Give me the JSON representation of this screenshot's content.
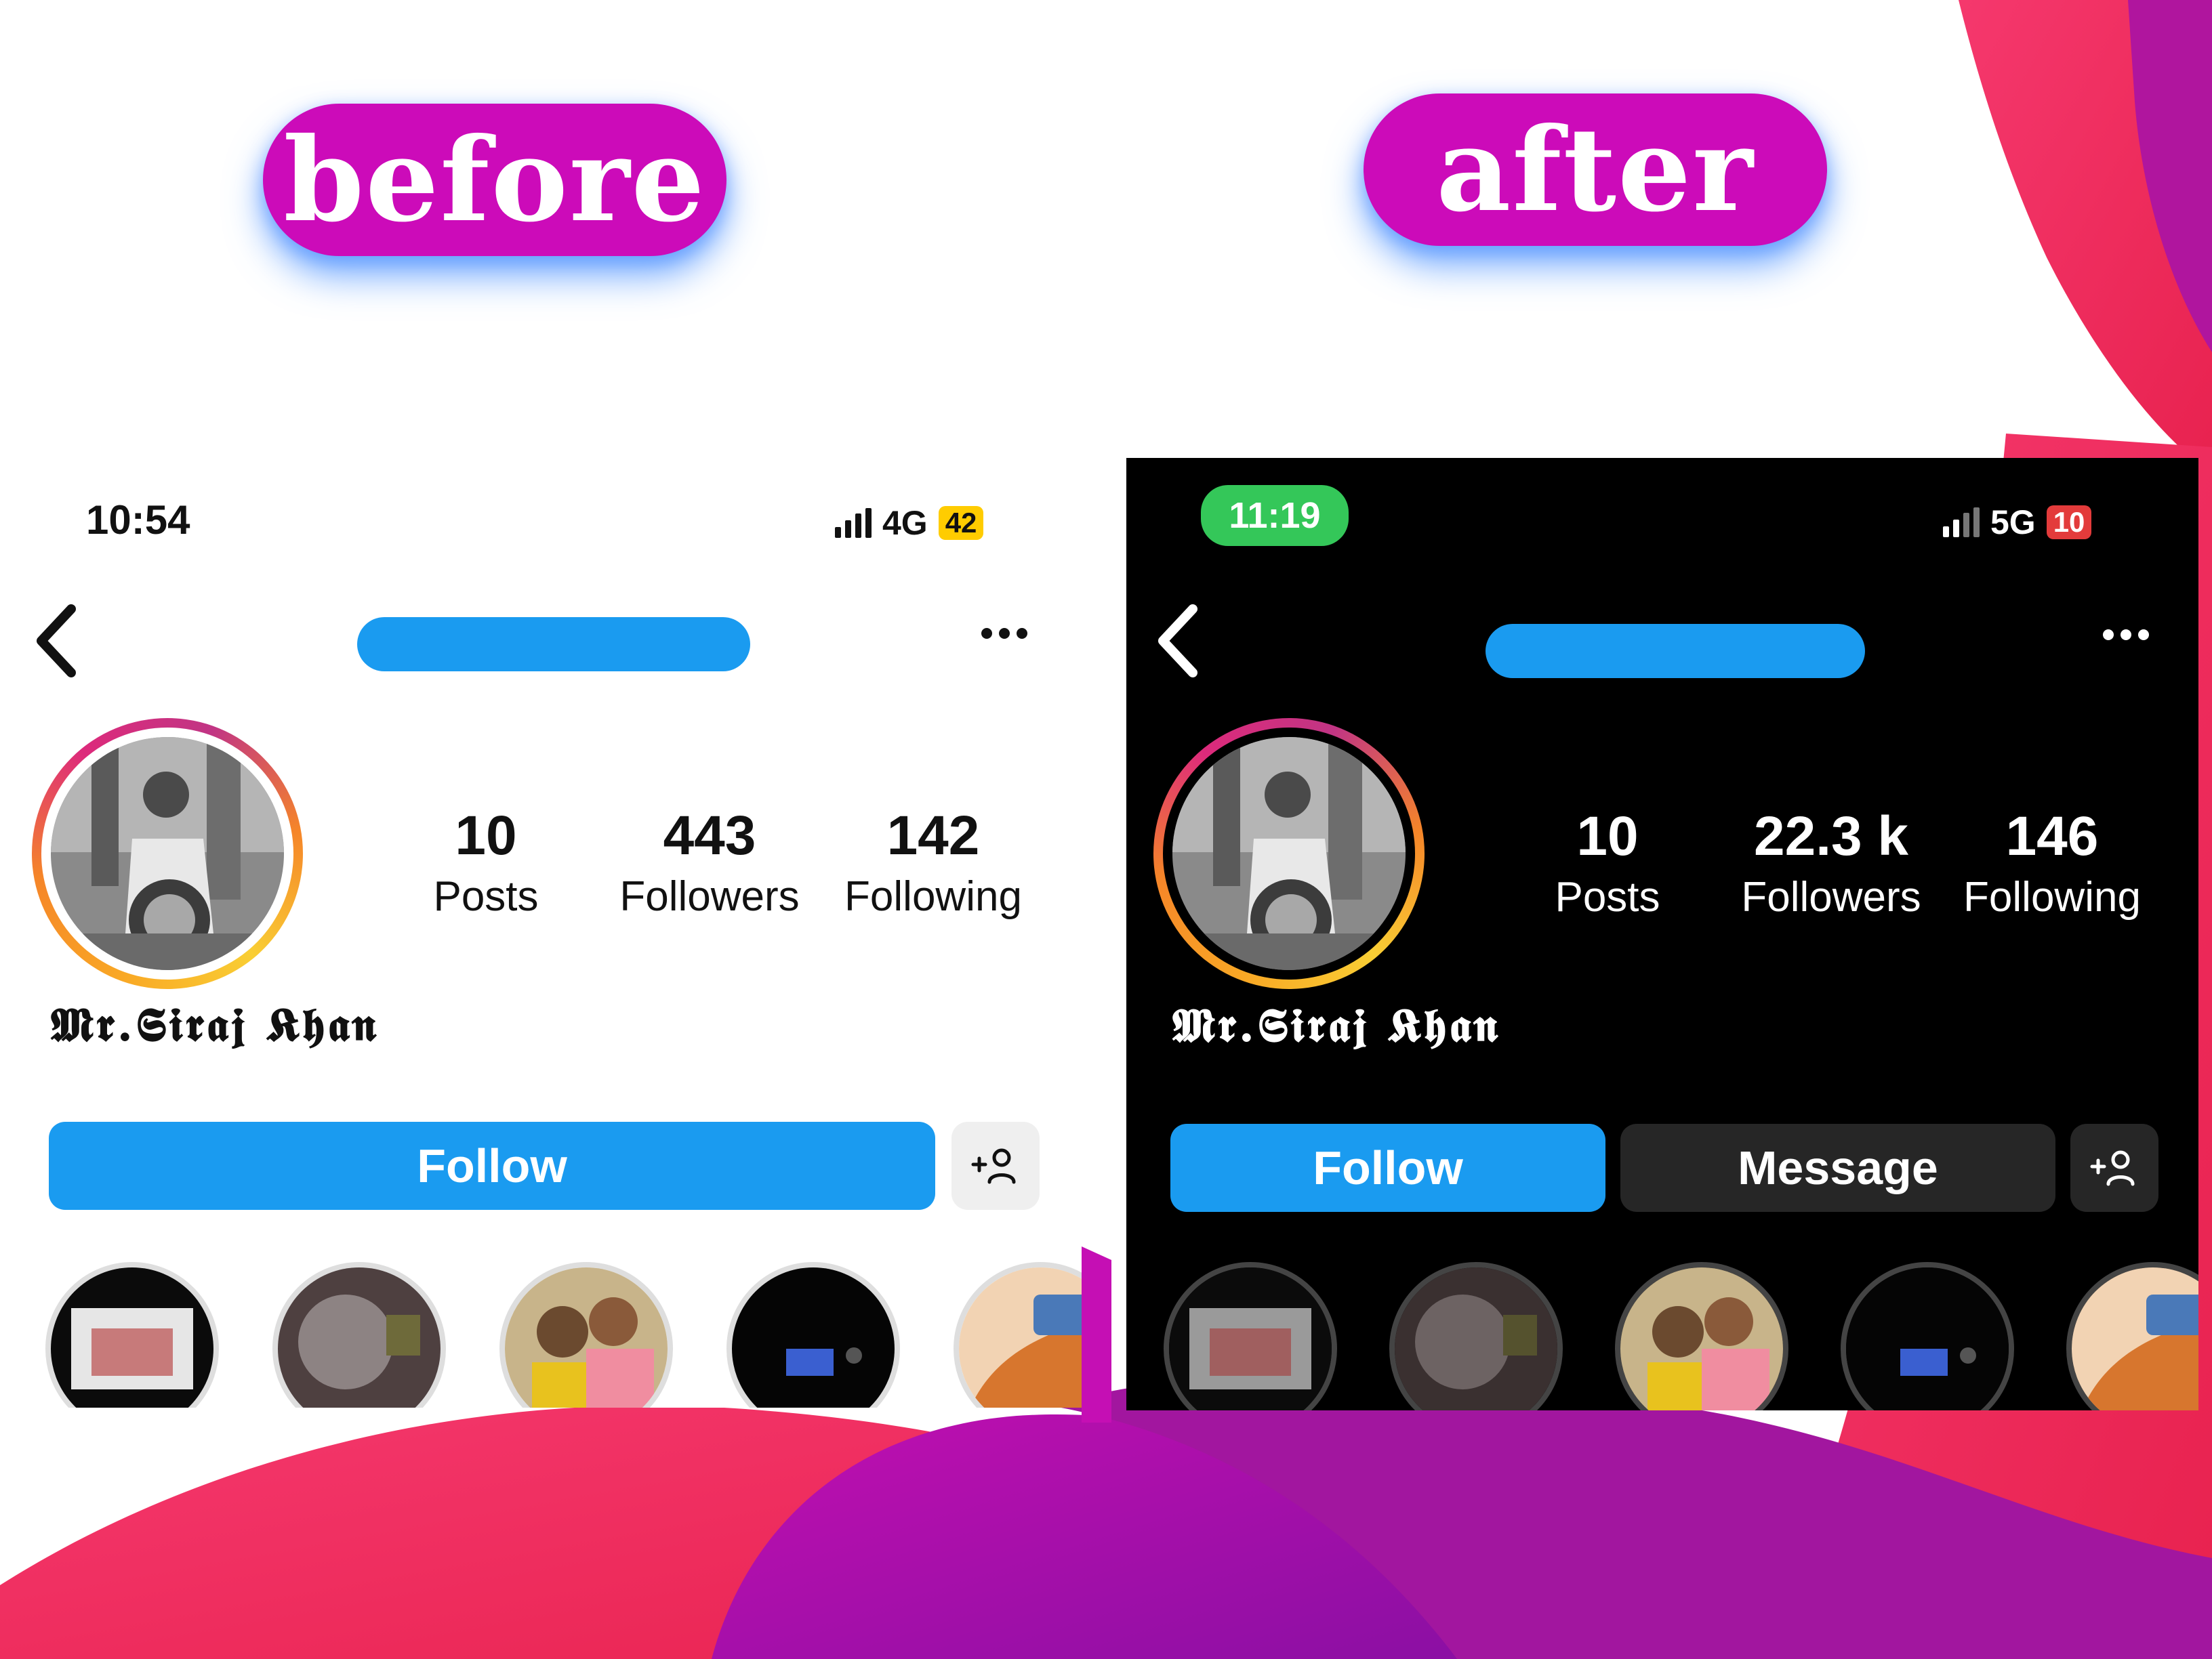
{
  "labels": {
    "before": "before",
    "after": "after"
  },
  "colors": {
    "pill": "#cc0bb9",
    "follow_blue": "#1a9bf0",
    "redaction_blue": "#1a9bf0",
    "background_magenta": "#a4139f",
    "background_red": "#f0295f",
    "clock_green": "#34c759",
    "battery_yellow": "#ffcc00",
    "battery_red": "#e33b3b"
  },
  "before": {
    "status": {
      "time": "10:54",
      "network": "4G",
      "battery": "42"
    },
    "stats": [
      {
        "value": "10",
        "label": "Posts"
      },
      {
        "value": "443",
        "label": "Followers"
      },
      {
        "value": "142",
        "label": "Following"
      }
    ],
    "display_name": "𝕸𝖗.𝕾𝖎𝖗𝖆𝖏 𝕶𝖍𝖆𝖓",
    "buttons": {
      "follow": "Follow"
    },
    "icons": {
      "back": "chevron-left-icon",
      "more": "more-dots-icon",
      "add_person": "add-person-icon"
    }
  },
  "after": {
    "status": {
      "time": "11:19",
      "network": "5G",
      "battery": "10"
    },
    "stats": [
      {
        "value": "10",
        "label": "Posts"
      },
      {
        "value": "22.3 k",
        "label": "Followers"
      },
      {
        "value": "146",
        "label": "Following"
      }
    ],
    "display_name": "𝕸𝖗.𝕾𝖎𝖗𝖆𝖏 𝕶𝖍𝖆𝖓",
    "buttons": {
      "follow": "Follow",
      "message": "Message"
    },
    "icons": {
      "back": "chevron-left-icon",
      "more": "more-dots-icon",
      "add_person": "add-person-icon"
    }
  }
}
